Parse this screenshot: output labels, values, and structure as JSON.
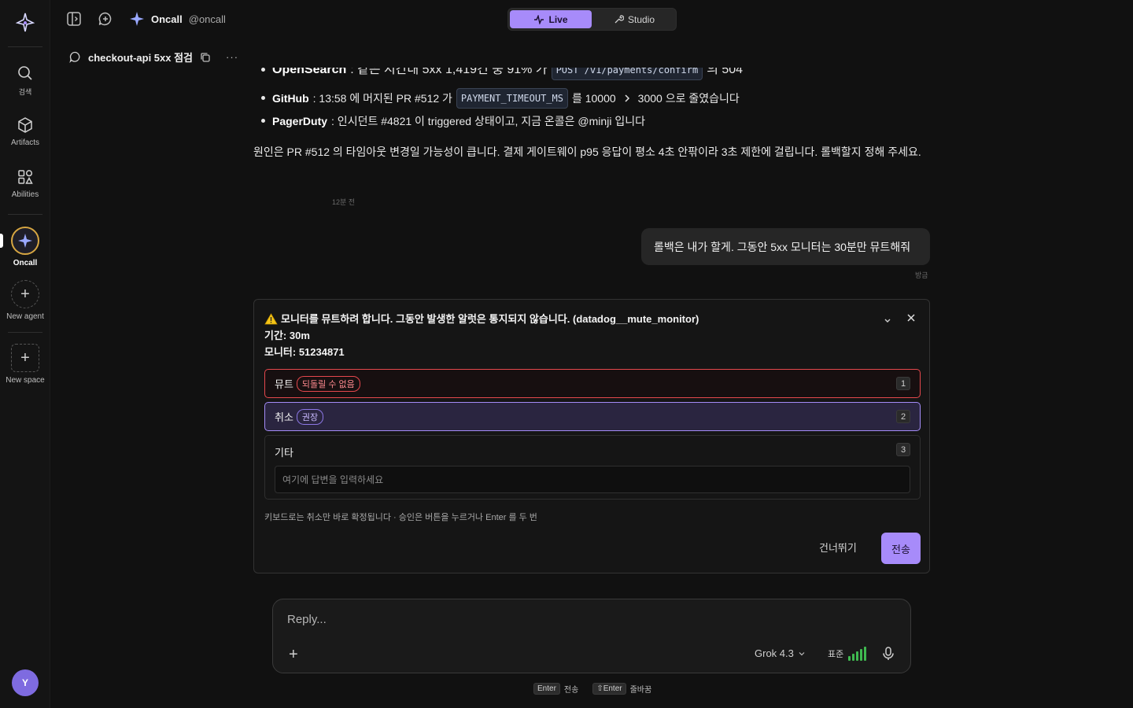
{
  "rail": {
    "items": [
      {
        "label": "검색"
      },
      {
        "label": "Artifacts"
      },
      {
        "label": "Abilities"
      },
      {
        "label": "Oncall"
      },
      {
        "label": "New agent"
      },
      {
        "label": "New space"
      }
    ],
    "user_initial": "Y"
  },
  "topbar": {
    "agent_name": "Oncall",
    "agent_handle": "@oncall",
    "mode_live": "Live",
    "mode_studio": "Studio"
  },
  "thread": {
    "title": "checkout-api 5xx 점검",
    "more": "···"
  },
  "message": {
    "bullets": [
      {
        "source": "OpenSearch",
        "pre": ": 같은 시간대 5xx 1,419건 중 91% 가",
        "code": "POST /v1/payments/confirm",
        "post": "의 504"
      },
      {
        "source": "GitHub",
        "pre": ": 13:58 에 머지된 PR #512 가",
        "code": "PAYMENT_TIMEOUT_MS",
        "mid": "를 10000",
        "post": "3000 으로 줄였습니다"
      },
      {
        "source": "PagerDuty",
        "pre": ": 인시던트 #4821 이 triggered 상태이고, 지금 온콜은 @minji 입니다"
      }
    ],
    "conclusion": "원인은 PR #512 의 타임아웃 변경일 가능성이 큽니다. 결제 게이트웨이 p95 응답이 평소 4초 안팎이라 3초 제한에 걸립니다. 롤백할지 정해 주세요.",
    "timestamp": "12분 전"
  },
  "user_message": {
    "text": "롤백은 내가 할게. 그동안 5xx 모니터는 30분만 뮤트해줘",
    "timestamp": "방금"
  },
  "approval": {
    "title": "모니터를 뮤트하려 합니다. 그동안 발생한 알럿은 통지되지 않습니다. (datadog__mute_monitor)",
    "duration": "기간: 30m",
    "monitor": "모니터: 51234871",
    "options": [
      {
        "label": "뮤트",
        "tag": "되돌릴 수 없음",
        "key": "1"
      },
      {
        "label": "취소",
        "tag": "권장",
        "key": "2"
      },
      {
        "label": "기타",
        "key": "3",
        "placeholder": "여기에 답변을 입력하세요"
      }
    ],
    "hint": "키보드로는 취소만 바로 확정됩니다 · 승인은 버튼을 누르거나 Enter 를 두 번",
    "skip_label": "건너뛰기",
    "send_label": "전송"
  },
  "composer": {
    "placeholder": "Reply...",
    "model": "Grok 4.3",
    "effort": "표준"
  },
  "shortcuts": {
    "enter_key": "Enter",
    "enter_action": "전송",
    "shift_enter_key": "⇧Enter",
    "shift_enter_action": "줄바꿈"
  },
  "colors": {
    "accent": "#a78bfa",
    "danger": "#e5484d",
    "oncall_ring": "#d6a642",
    "signal": "#3fb950"
  }
}
